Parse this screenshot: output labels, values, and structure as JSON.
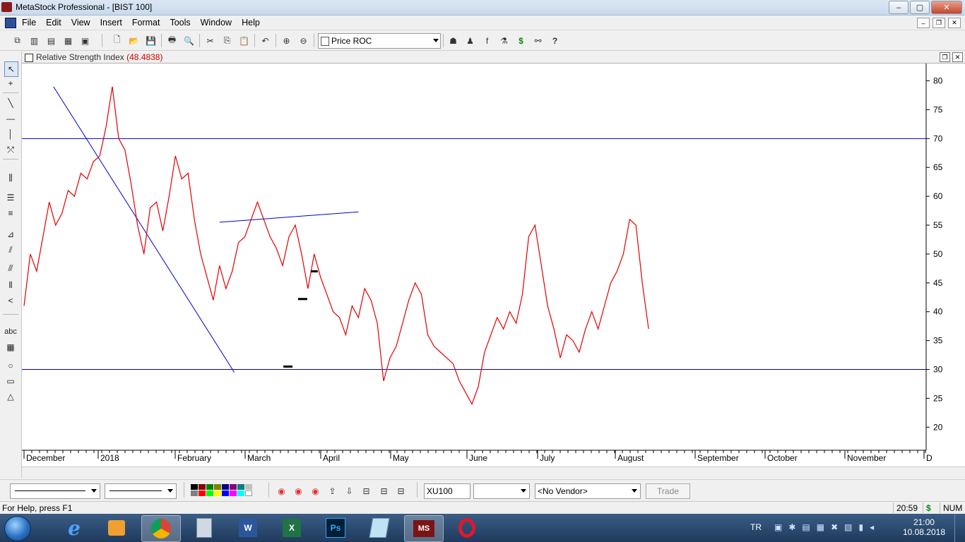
{
  "window": {
    "title": "MetaStock Professional - [BIST 100]",
    "controls": {
      "minimize": "–",
      "maximize": "▢",
      "close": "✕"
    }
  },
  "menu": [
    "File",
    "Edit",
    "View",
    "Insert",
    "Format",
    "Tools",
    "Window",
    "Help"
  ],
  "toolbar": {
    "indicator_combo": "Price ROC",
    "buttons": [
      "new-chart",
      "new-layout",
      "open",
      "save",
      "print",
      "print-preview",
      "cut",
      "copy",
      "paste",
      "undo",
      "crosshair",
      "zoom",
      "explorer",
      "system-tester",
      "indicator-builder",
      "expert-advisor",
      "dollar",
      "binoculars",
      "help"
    ]
  },
  "chart_window": {
    "header_label": "Relative Strength Index",
    "header_value": "(48.4838)"
  },
  "chart_data": {
    "type": "line",
    "title": "Relative Strength Index",
    "series": [
      {
        "name": "",
        "color": "#e00000",
        "x": [
          0,
          3,
          6,
          9,
          12,
          15,
          18,
          21,
          24,
          27,
          30,
          33,
          36,
          39,
          42,
          45,
          48,
          51,
          54,
          57,
          60,
          63,
          66,
          69,
          72,
          75,
          78,
          81,
          84,
          87,
          90,
          93,
          96,
          99,
          102,
          105,
          108,
          111,
          114,
          117,
          120,
          123,
          126,
          129,
          132,
          135,
          138,
          141,
          144,
          147,
          150,
          153,
          156,
          159,
          162,
          165,
          168,
          171,
          174,
          177,
          180,
          183,
          186,
          189,
          192,
          195,
          198,
          201,
          204,
          207,
          210,
          213,
          216,
          219,
          222,
          225,
          228,
          231,
          234,
          237,
          240,
          243,
          246,
          249,
          252,
          255,
          258,
          261,
          264,
          267,
          270,
          273,
          276,
          279,
          282,
          285,
          288,
          291,
          294,
          297
        ],
        "values": [
          41,
          50,
          47,
          53,
          59,
          55,
          57,
          61,
          60,
          64,
          63,
          66,
          67,
          72,
          79,
          70,
          68,
          62,
          55,
          50,
          58,
          59,
          54,
          60,
          67,
          63,
          64,
          56,
          50,
          46,
          42,
          48,
          44,
          47,
          52,
          53,
          56,
          59,
          56,
          53,
          51,
          48,
          53,
          55,
          50,
          44,
          50,
          46,
          43,
          40,
          39,
          36,
          41,
          39,
          44,
          42,
          38,
          28,
          32,
          34,
          38,
          42,
          45,
          43,
          36,
          34,
          33,
          32,
          31,
          28,
          26,
          24,
          27,
          33,
          36,
          39,
          37,
          40,
          38,
          43,
          53,
          55,
          48,
          41,
          37,
          32,
          36,
          35,
          33,
          37,
          40,
          37,
          41,
          45,
          47,
          50,
          56,
          55,
          45,
          37
        ]
      }
    ],
    "x_tick_labels": [
      "December",
      "2018",
      "February",
      "March",
      "April",
      "May",
      "June",
      "July",
      "August",
      "September",
      "October",
      "November",
      "D"
    ],
    "y_ticks": [
      20,
      25,
      30,
      35,
      40,
      45,
      50,
      55,
      60,
      65,
      70,
      75,
      80
    ],
    "ylim": [
      16,
      83
    ],
    "horizontal_lines": [
      {
        "value": 70,
        "color": "#0000cc"
      },
      {
        "value": 30,
        "color": "#0000cc"
      }
    ],
    "trendlines": [
      {
        "from": [
          14,
          79
        ],
        "to": [
          100,
          29.5
        ],
        "color": "#0000cc"
      },
      {
        "from": [
          93,
          55.5
        ],
        "to": [
          159,
          57.3
        ],
        "color": "#0000cc"
      }
    ],
    "support_marks": [
      {
        "from": [
          124,
          30.5
        ],
        "to": [
          127,
          30.5
        ]
      },
      {
        "from": [
          131,
          42.2
        ],
        "to": [
          134,
          42.2
        ]
      },
      {
        "from": [
          137,
          47.0
        ],
        "to": [
          139,
          47.0
        ]
      }
    ],
    "grid": false,
    "last_value": 48.4838
  },
  "bottom_toolbar": {
    "security_field": "XU100",
    "period_select": "",
    "vendor_select": "<No Vendor>",
    "trade_button": "Trade"
  },
  "statusbar": {
    "help": "For Help, press F1",
    "time": "20:59",
    "dollar": "$",
    "num": "NUM"
  },
  "taskbar": {
    "apps": [
      "internet-explorer",
      "media-player",
      "chrome",
      "calculator",
      "word",
      "excel",
      "photoshop",
      "notepad",
      "metastock",
      "opera"
    ],
    "language": "TR",
    "clock_time": "21:00",
    "clock_date": "10.08.2018"
  }
}
